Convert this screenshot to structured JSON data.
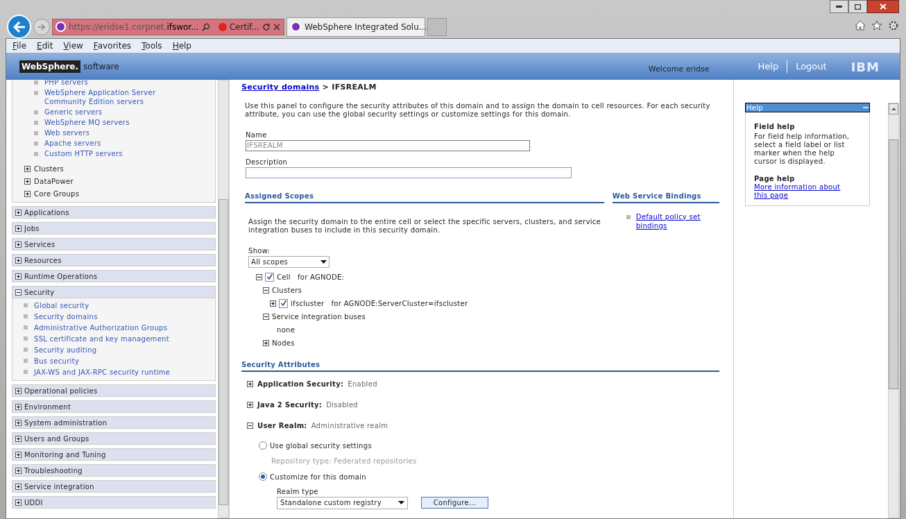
{
  "browser": {
    "address_dim": "https://eridse1.corpnet.",
    "address_strong": "ifswor...",
    "cert": "Certif...",
    "tabs": [
      {
        "title": "WebSphere Integrated Solu...",
        "selected": true
      }
    ]
  },
  "menu": [
    "File",
    "Edit",
    "View",
    "Favorites",
    "Tools",
    "Help"
  ],
  "header": {
    "brand": "WebSphere.",
    "brand_sub": "software",
    "welcome": "Welcome eridse",
    "links": [
      "Help",
      "Logout"
    ],
    "logo": "IBM"
  },
  "nav": {
    "server_links": [
      "PHP servers",
      "WebSphere Application Server Community Edition servers",
      "Generic servers",
      "WebSphere MQ servers",
      "Web servers",
      "Apache servers",
      "Custom HTTP servers"
    ],
    "tree": [
      {
        "label": "Clusters",
        "expanded": false
      },
      {
        "label": "DataPower",
        "expanded": false
      },
      {
        "label": "Core Groups",
        "expanded": false
      }
    ],
    "groups": [
      {
        "label": "Applications",
        "expanded": false
      },
      {
        "label": "Jobs",
        "expanded": false
      },
      {
        "label": "Services",
        "expanded": false
      },
      {
        "label": "Resources",
        "expanded": false
      },
      {
        "label": "Runtime Operations",
        "expanded": false
      },
      {
        "label": "Security",
        "expanded": true,
        "children": [
          "Global security",
          "Security domains",
          "Administrative Authorization Groups",
          "SSL certificate and key management",
          "Security auditing",
          "Bus security",
          "JAX-WS and JAX-RPC security runtime"
        ]
      },
      {
        "label": "Operational policies",
        "expanded": false
      },
      {
        "label": "Environment",
        "expanded": false
      },
      {
        "label": "System administration",
        "expanded": false
      },
      {
        "label": "Users and Groups",
        "expanded": false
      },
      {
        "label": "Monitoring and Tuning",
        "expanded": false
      },
      {
        "label": "Troubleshooting",
        "expanded": false
      },
      {
        "label": "Service integration",
        "expanded": false
      },
      {
        "label": "UDDI",
        "expanded": false
      }
    ]
  },
  "main": {
    "breadcrumb": {
      "link": "Security domains",
      "separator": ">",
      "current": "IFSREALM"
    },
    "intro": "Use this panel to configure the security attributes of this domain and to assign the domain to cell resources. For each security attribute, you can use the global security settings or customize settings for this domain.",
    "name_field": {
      "label": "Name",
      "value": "IFSREALM",
      "disabled": true
    },
    "description_field": {
      "label": "Description"
    },
    "scopes": {
      "title": "Assigned Scopes",
      "text": "Assign the security domain to the entire cell or select the specific servers, clusters, and service integration buses to include in this security domain.",
      "show_label": "Show:",
      "show_value": "All scopes",
      "tree": [
        {
          "kind": "check",
          "label": "Cell",
          "detail": "for AGNODE:",
          "expanded": true,
          "checked": true,
          "children": [
            {
              "kind": "folder",
              "label": "Clusters",
              "expanded": true,
              "children": [
                {
                  "kind": "check",
                  "label": "ifscluster",
                  "detail": "for AGNODE:ServerCluster=ifscluster",
                  "expanded": false,
                  "checked": true
                }
              ]
            },
            {
              "kind": "folder",
              "label": "Service integration buses",
              "expanded": true,
              "children": [
                {
                  "kind": "text",
                  "label": "none"
                }
              ]
            },
            {
              "kind": "folder",
              "label": "Nodes",
              "expanded": false
            }
          ]
        }
      ]
    },
    "bindings": {
      "title": "Web Service Bindings",
      "links": [
        "Default policy set bindings"
      ]
    },
    "attributes": {
      "title": "Security Attributes",
      "items": [
        {
          "label": "Application Security:",
          "value": "Enabled",
          "expanded": false
        },
        {
          "label": "Java 2 Security:",
          "value": "Disabled",
          "expanded": false
        },
        {
          "label": "User Realm:",
          "value": "Administrative realm",
          "expanded": true
        }
      ],
      "realm_options": [
        {
          "label": "Use global security settings",
          "note": "Repository type: Federated repositories",
          "selected": false
        },
        {
          "label": "Customize for this domain",
          "selected": true
        }
      ],
      "realm_type_label": "Realm type",
      "realm_type_value": "Standalone custom registry",
      "configure": "Configure..."
    }
  },
  "help": {
    "title": "Help",
    "field_help_title": "Field help",
    "field_help": "For field help information, select a field label or list marker when the help cursor is displayed.",
    "page_help_title": "Page help",
    "page_help_link": "More information about this page"
  }
}
